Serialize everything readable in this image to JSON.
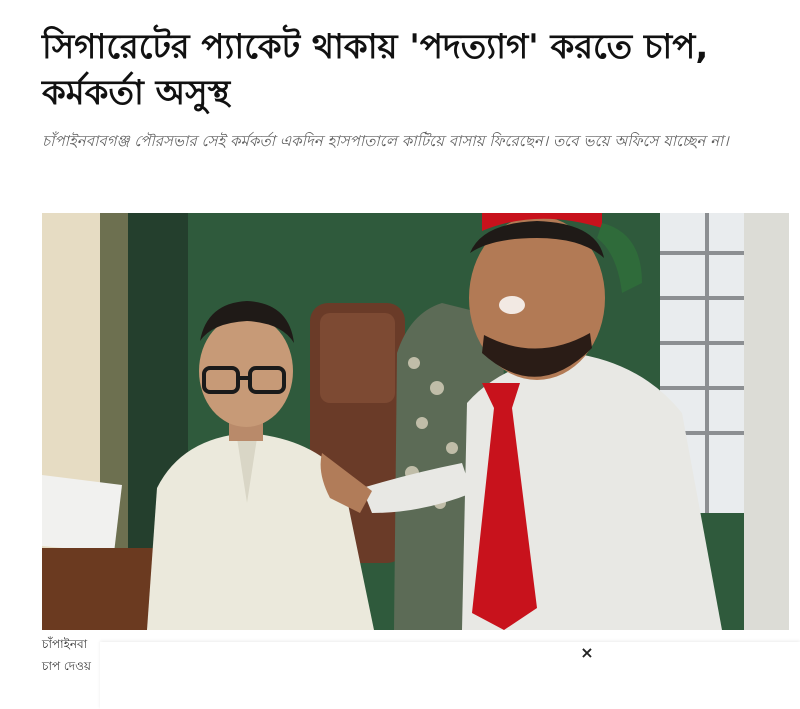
{
  "article": {
    "headline": "সিগারেটের প্যাকেট থাকায় 'পদত্যাগ' করতে চাপ, কর্মকর্তা অসুস্থ",
    "subhead": "চাঁপাইনবাবগঞ্জ পৌরসভার সেই কর্মকর্তা একদিন হাসপাতালে কাটিয়ে বাসায় ফিরেছেন। তবে ভয়ে অফিসে যাচ্ছেন না।",
    "caption_visible": "চাঁপাইনবা",
    "caption_line2": "চাপ দেওয়"
  },
  "ad": {
    "close_symbol": "×"
  },
  "colors": {
    "headline": "#111111",
    "subhead": "#5f5f5f",
    "wall_green": "#2f5a3c",
    "shirt_white": "#e8e8e4",
    "tie_red": "#c8121c"
  },
  "photo": {
    "description_icon": "news-photo"
  }
}
